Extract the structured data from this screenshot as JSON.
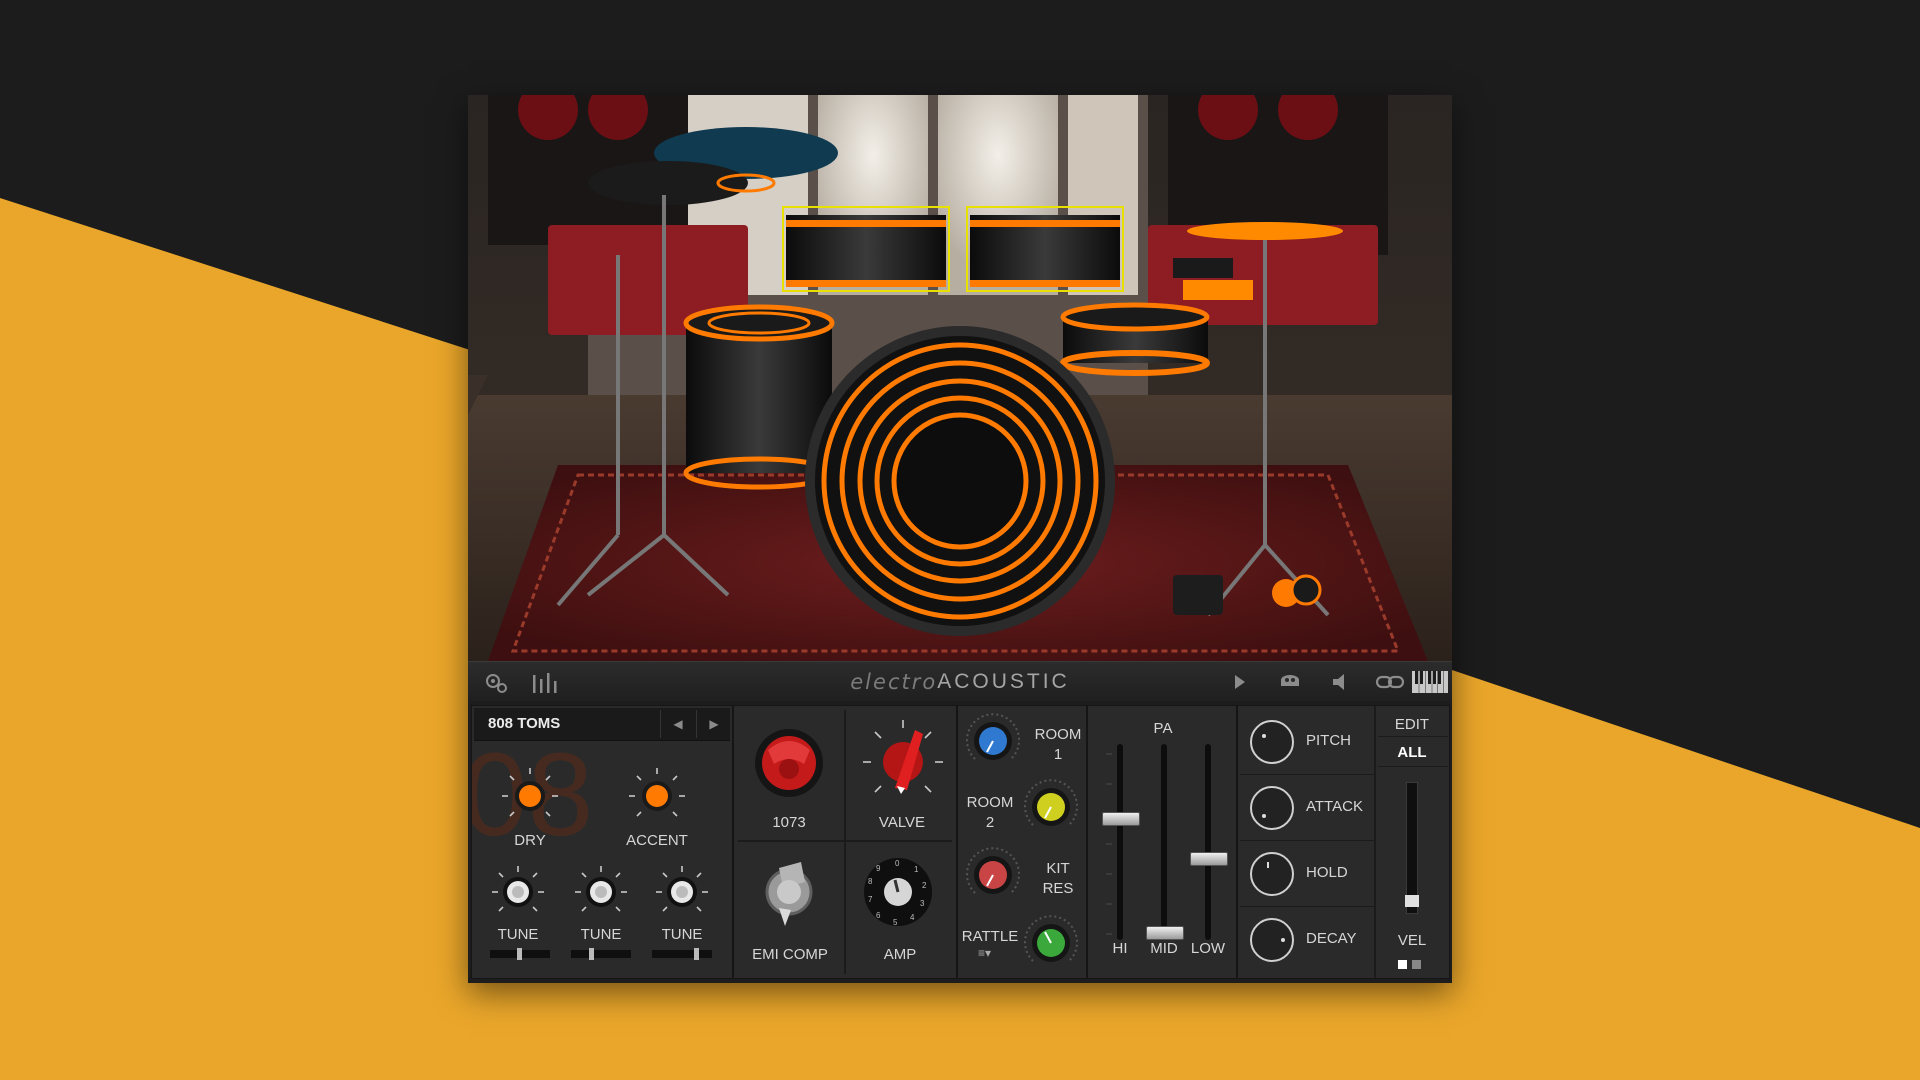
{
  "colors": {
    "background_dark": "#1c1c1c",
    "accent_orange": "#e9a62a",
    "panel": "#2a2a2a",
    "drum_glow": "#ff7a00"
  },
  "toolbar": {
    "title_light": "electro",
    "title_bold": "ACOUSTIC",
    "icons": [
      "gear-icon",
      "mixer-icon",
      "play-icon",
      "drum-icon",
      "speaker-icon",
      "link-icon",
      "keyboard-icon"
    ]
  },
  "preset": {
    "name": "808 TOMS",
    "prev_icon": "arrow-left-icon",
    "next_icon": "arrow-right-icon"
  },
  "voice": {
    "dry_label": "DRY",
    "accent_label": "ACCENT",
    "tune_labels": [
      "TUNE",
      "TUNE",
      "TUNE"
    ]
  },
  "processing": {
    "comp_1073_label": "1073",
    "valve_label": "VALVE",
    "emi_comp_label": "EMI COMP",
    "amp_label": "AMP"
  },
  "room": {
    "room1_label_a": "ROOM",
    "room1_label_b": "1",
    "room2_label_a": "ROOM",
    "room2_label_b": "2",
    "kitres_label_a": "KIT",
    "kitres_label_b": "RES",
    "rattle_label": "RATTLE"
  },
  "pa": {
    "title": "PA",
    "fader_labels": [
      "HI",
      "MID",
      "LOW"
    ]
  },
  "envelope": {
    "labels": [
      "PITCH",
      "ATTACK",
      "HOLD",
      "DECAY"
    ],
    "edit_label": "EDIT",
    "all_label": "ALL",
    "vel_label": "VEL"
  }
}
